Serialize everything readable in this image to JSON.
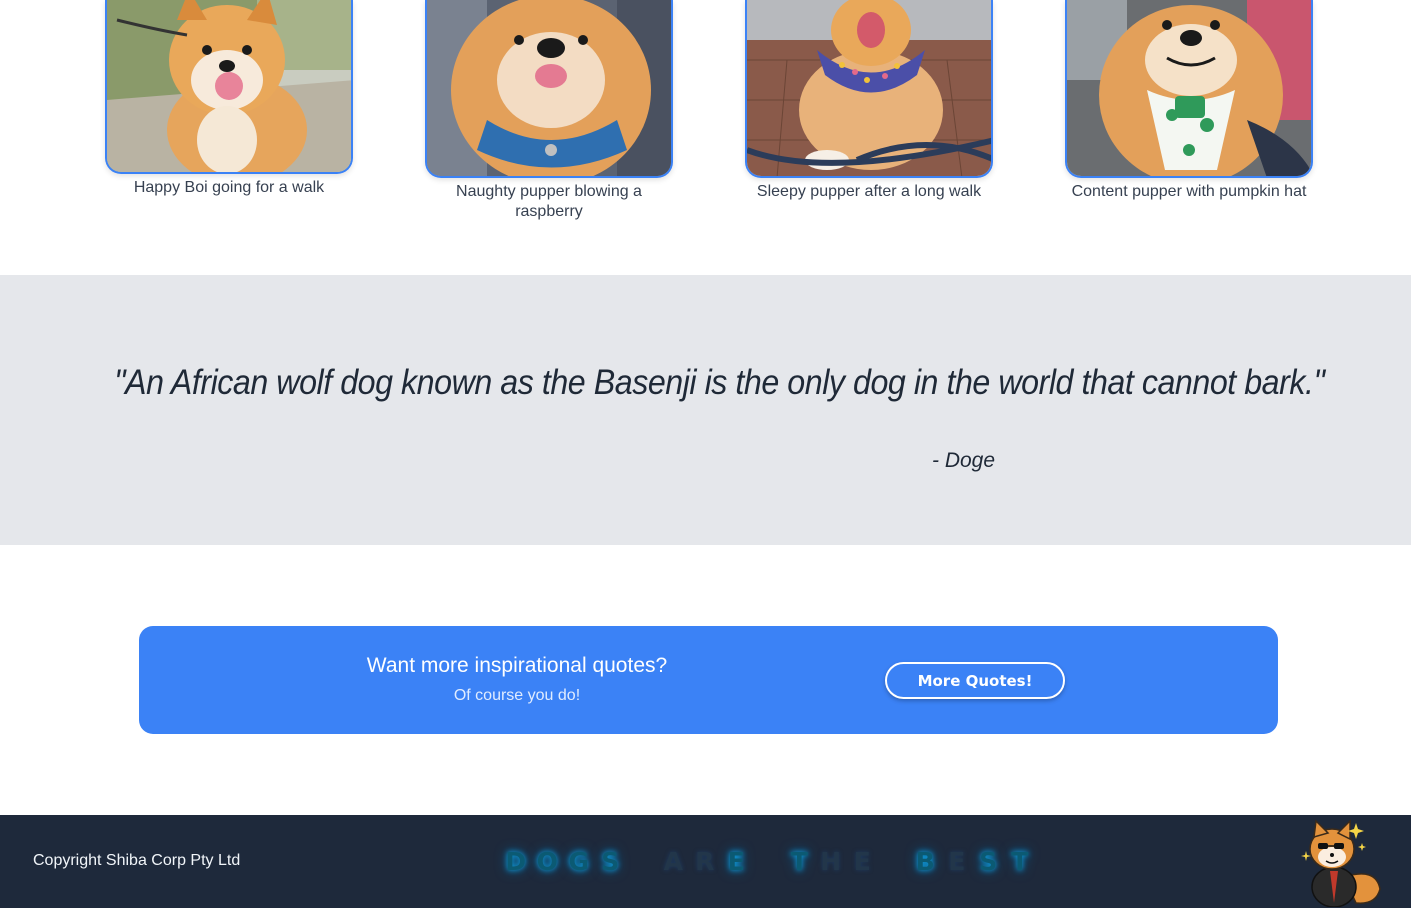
{
  "gallery": {
    "cards": [
      {
        "caption": "Happy Boi going for a walk"
      },
      {
        "caption": "Naughty pupper blowing a raspberry"
      },
      {
        "caption": "Sleepy pupper after a long walk"
      },
      {
        "caption": "Content pupper with pumpkin hat"
      }
    ]
  },
  "quote": {
    "text": "\"An African wolf dog known as the Basenji is the only dog in the world that cannot bark.\"",
    "author": "- Doge"
  },
  "cta": {
    "title": "Want more inspirational quotes?",
    "subtitle": "Of course you do!",
    "button_label": "More Quotes!"
  },
  "footer": {
    "copyright": "Copyright Shiba Corp Pty Ltd",
    "neon_letters": [
      "D",
      "O",
      "G",
      "S",
      " ",
      "A",
      "R",
      "E",
      " ",
      "T",
      "H",
      "E",
      " ",
      "B",
      "E",
      "S",
      "T"
    ],
    "mascot": "shiba-mascot-icon"
  },
  "colors": {
    "accent": "#3b82f6",
    "quote_bg": "#e5e7eb",
    "footer_bg": "#1e293b",
    "neon": "#0ea5e9"
  }
}
